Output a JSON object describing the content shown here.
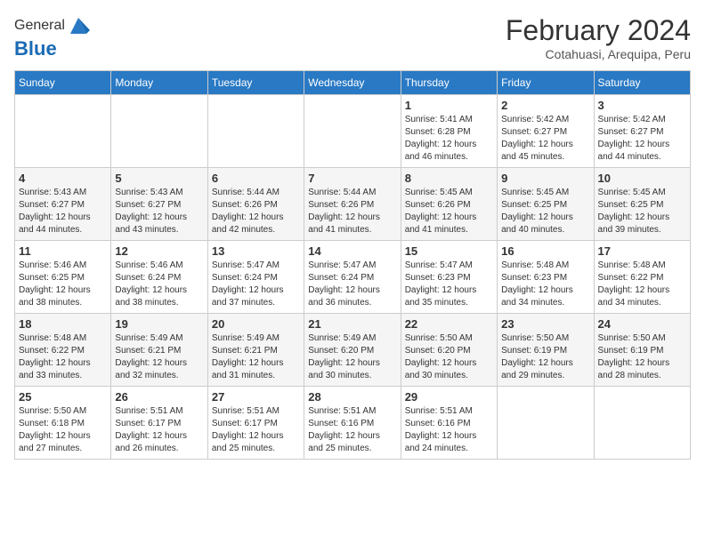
{
  "header": {
    "logo_line1": "General",
    "logo_line2": "Blue",
    "month_year": "February 2024",
    "location": "Cotahuasi, Arequipa, Peru"
  },
  "days_of_week": [
    "Sunday",
    "Monday",
    "Tuesday",
    "Wednesday",
    "Thursday",
    "Friday",
    "Saturday"
  ],
  "weeks": [
    [
      {
        "day": "",
        "info": ""
      },
      {
        "day": "",
        "info": ""
      },
      {
        "day": "",
        "info": ""
      },
      {
        "day": "",
        "info": ""
      },
      {
        "day": "1",
        "info": "Sunrise: 5:41 AM\nSunset: 6:28 PM\nDaylight: 12 hours\nand 46 minutes."
      },
      {
        "day": "2",
        "info": "Sunrise: 5:42 AM\nSunset: 6:27 PM\nDaylight: 12 hours\nand 45 minutes."
      },
      {
        "day": "3",
        "info": "Sunrise: 5:42 AM\nSunset: 6:27 PM\nDaylight: 12 hours\nand 44 minutes."
      }
    ],
    [
      {
        "day": "4",
        "info": "Sunrise: 5:43 AM\nSunset: 6:27 PM\nDaylight: 12 hours\nand 44 minutes."
      },
      {
        "day": "5",
        "info": "Sunrise: 5:43 AM\nSunset: 6:27 PM\nDaylight: 12 hours\nand 43 minutes."
      },
      {
        "day": "6",
        "info": "Sunrise: 5:44 AM\nSunset: 6:26 PM\nDaylight: 12 hours\nand 42 minutes."
      },
      {
        "day": "7",
        "info": "Sunrise: 5:44 AM\nSunset: 6:26 PM\nDaylight: 12 hours\nand 41 minutes."
      },
      {
        "day": "8",
        "info": "Sunrise: 5:45 AM\nSunset: 6:26 PM\nDaylight: 12 hours\nand 41 minutes."
      },
      {
        "day": "9",
        "info": "Sunrise: 5:45 AM\nSunset: 6:25 PM\nDaylight: 12 hours\nand 40 minutes."
      },
      {
        "day": "10",
        "info": "Sunrise: 5:45 AM\nSunset: 6:25 PM\nDaylight: 12 hours\nand 39 minutes."
      }
    ],
    [
      {
        "day": "11",
        "info": "Sunrise: 5:46 AM\nSunset: 6:25 PM\nDaylight: 12 hours\nand 38 minutes."
      },
      {
        "day": "12",
        "info": "Sunrise: 5:46 AM\nSunset: 6:24 PM\nDaylight: 12 hours\nand 38 minutes."
      },
      {
        "day": "13",
        "info": "Sunrise: 5:47 AM\nSunset: 6:24 PM\nDaylight: 12 hours\nand 37 minutes."
      },
      {
        "day": "14",
        "info": "Sunrise: 5:47 AM\nSunset: 6:24 PM\nDaylight: 12 hours\nand 36 minutes."
      },
      {
        "day": "15",
        "info": "Sunrise: 5:47 AM\nSunset: 6:23 PM\nDaylight: 12 hours\nand 35 minutes."
      },
      {
        "day": "16",
        "info": "Sunrise: 5:48 AM\nSunset: 6:23 PM\nDaylight: 12 hours\nand 34 minutes."
      },
      {
        "day": "17",
        "info": "Sunrise: 5:48 AM\nSunset: 6:22 PM\nDaylight: 12 hours\nand 34 minutes."
      }
    ],
    [
      {
        "day": "18",
        "info": "Sunrise: 5:48 AM\nSunset: 6:22 PM\nDaylight: 12 hours\nand 33 minutes."
      },
      {
        "day": "19",
        "info": "Sunrise: 5:49 AM\nSunset: 6:21 PM\nDaylight: 12 hours\nand 32 minutes."
      },
      {
        "day": "20",
        "info": "Sunrise: 5:49 AM\nSunset: 6:21 PM\nDaylight: 12 hours\nand 31 minutes."
      },
      {
        "day": "21",
        "info": "Sunrise: 5:49 AM\nSunset: 6:20 PM\nDaylight: 12 hours\nand 30 minutes."
      },
      {
        "day": "22",
        "info": "Sunrise: 5:50 AM\nSunset: 6:20 PM\nDaylight: 12 hours\nand 30 minutes."
      },
      {
        "day": "23",
        "info": "Sunrise: 5:50 AM\nSunset: 6:19 PM\nDaylight: 12 hours\nand 29 minutes."
      },
      {
        "day": "24",
        "info": "Sunrise: 5:50 AM\nSunset: 6:19 PM\nDaylight: 12 hours\nand 28 minutes."
      }
    ],
    [
      {
        "day": "25",
        "info": "Sunrise: 5:50 AM\nSunset: 6:18 PM\nDaylight: 12 hours\nand 27 minutes."
      },
      {
        "day": "26",
        "info": "Sunrise: 5:51 AM\nSunset: 6:17 PM\nDaylight: 12 hours\nand 26 minutes."
      },
      {
        "day": "27",
        "info": "Sunrise: 5:51 AM\nSunset: 6:17 PM\nDaylight: 12 hours\nand 25 minutes."
      },
      {
        "day": "28",
        "info": "Sunrise: 5:51 AM\nSunset: 6:16 PM\nDaylight: 12 hours\nand 25 minutes."
      },
      {
        "day": "29",
        "info": "Sunrise: 5:51 AM\nSunset: 6:16 PM\nDaylight: 12 hours\nand 24 minutes."
      },
      {
        "day": "",
        "info": ""
      },
      {
        "day": "",
        "info": ""
      }
    ]
  ]
}
